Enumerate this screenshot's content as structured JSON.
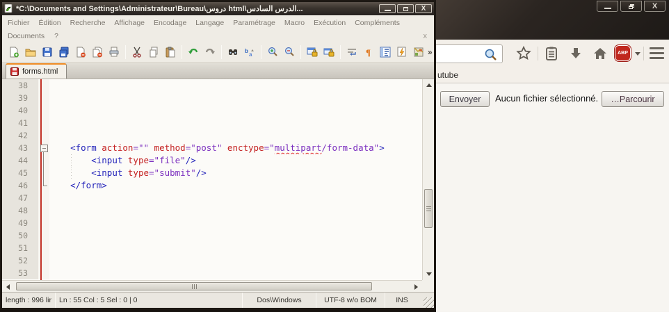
{
  "editor_window": {
    "title": "*C:\\Documents and Settings\\Administrateur\\Bureau\\دروس html\\الدرس السادس...",
    "menu": {
      "items": [
        "Fichier",
        "Édition",
        "Recherche",
        "Affichage",
        "Encodage",
        "Langage",
        "Paramétrage",
        "Macro",
        "Exécution",
        "Compléments"
      ],
      "row2_items": [
        "Documents",
        "?"
      ],
      "close_x": "x"
    },
    "toolbar": {
      "overflow": "»",
      "icons": [
        "new-file",
        "open-file",
        "save",
        "save-all",
        "close-file",
        "close-all",
        "print",
        "cut",
        "copy",
        "paste",
        "undo",
        "redo",
        "find",
        "replace",
        "zoom-in",
        "zoom-out",
        "sync-vertical",
        "sync-horizontal",
        "word-wrap",
        "show-symbols",
        "function-list",
        "monitoring",
        "document-map"
      ]
    },
    "tab": {
      "label": "forms.html"
    },
    "code": {
      "lines": [
        {
          "n": 38,
          "fold": "",
          "tokens": []
        },
        {
          "n": 39,
          "fold": "",
          "tokens": []
        },
        {
          "n": 40,
          "fold": "",
          "tokens": []
        },
        {
          "n": 41,
          "fold": "",
          "tokens": []
        },
        {
          "n": 42,
          "fold": "",
          "tokens": []
        },
        {
          "n": 43,
          "fold": "start",
          "tokens": [
            {
              "c": "sp",
              "t": "    "
            },
            {
              "c": "tag",
              "t": "<form"
            },
            {
              "c": "sp",
              "t": " "
            },
            {
              "c": "attr",
              "t": "action"
            },
            {
              "c": "val",
              "t": "=\"\""
            },
            {
              "c": "sp",
              "t": " "
            },
            {
              "c": "attr",
              "t": "method"
            },
            {
              "c": "val",
              "t": "=\"post\""
            },
            {
              "c": "sp",
              "t": " "
            },
            {
              "c": "attr",
              "t": "enctype"
            },
            {
              "c": "val",
              "t": "=\""
            },
            {
              "c": "valm",
              "t": "multipart"
            },
            {
              "c": "val",
              "t": "/form-data\""
            },
            {
              "c": "tag",
              "t": ">"
            }
          ]
        },
        {
          "n": 44,
          "fold": "mid",
          "guide": true,
          "tokens": [
            {
              "c": "sp",
              "t": "        "
            },
            {
              "c": "tag",
              "t": "<input"
            },
            {
              "c": "sp",
              "t": " "
            },
            {
              "c": "attr",
              "t": "type"
            },
            {
              "c": "val",
              "t": "=\"file\""
            },
            {
              "c": "tag",
              "t": "/>"
            }
          ]
        },
        {
          "n": 45,
          "fold": "mid",
          "guide": true,
          "tokens": [
            {
              "c": "sp",
              "t": "        "
            },
            {
              "c": "tag",
              "t": "<input"
            },
            {
              "c": "sp",
              "t": " "
            },
            {
              "c": "attr",
              "t": "type"
            },
            {
              "c": "val",
              "t": "=\"submit\""
            },
            {
              "c": "tag",
              "t": "/>"
            }
          ]
        },
        {
          "n": 46,
          "fold": "end",
          "tokens": [
            {
              "c": "sp",
              "t": "    "
            },
            {
              "c": "tag",
              "t": "</form>"
            }
          ]
        },
        {
          "n": 47,
          "fold": "",
          "tokens": []
        },
        {
          "n": 48,
          "fold": "",
          "tokens": []
        },
        {
          "n": 49,
          "fold": "",
          "tokens": []
        },
        {
          "n": 50,
          "fold": "",
          "tokens": []
        },
        {
          "n": 51,
          "fold": "",
          "tokens": []
        },
        {
          "n": 52,
          "fold": "",
          "tokens": []
        },
        {
          "n": 53,
          "fold": "",
          "tokens": []
        }
      ]
    },
    "status_bar": {
      "length_info": "length : 996   lir",
      "position_info": "Ln : 55   Col : 5   Sel : 0 | 0",
      "eol_format": "Dos\\Windows",
      "encoding": "UTF-8 w/o BOM",
      "insert_mode": "INS"
    }
  },
  "browser_window": {
    "bookmarks_bar": {
      "item": "utube"
    },
    "adblock": {
      "label": "ABP"
    },
    "page": {
      "submit_label": "Envoyer",
      "file_status": "Aucun fichier sélectionné.",
      "browse_label": "…Parcourir"
    }
  },
  "colors": {
    "accent_orange": "#ef8b24",
    "code_tag": "#2323ba",
    "code_attr": "#c42222",
    "code_value": "#7b2fbf",
    "change_marker_red": "#c23227",
    "abp_red": "#c0281e"
  }
}
